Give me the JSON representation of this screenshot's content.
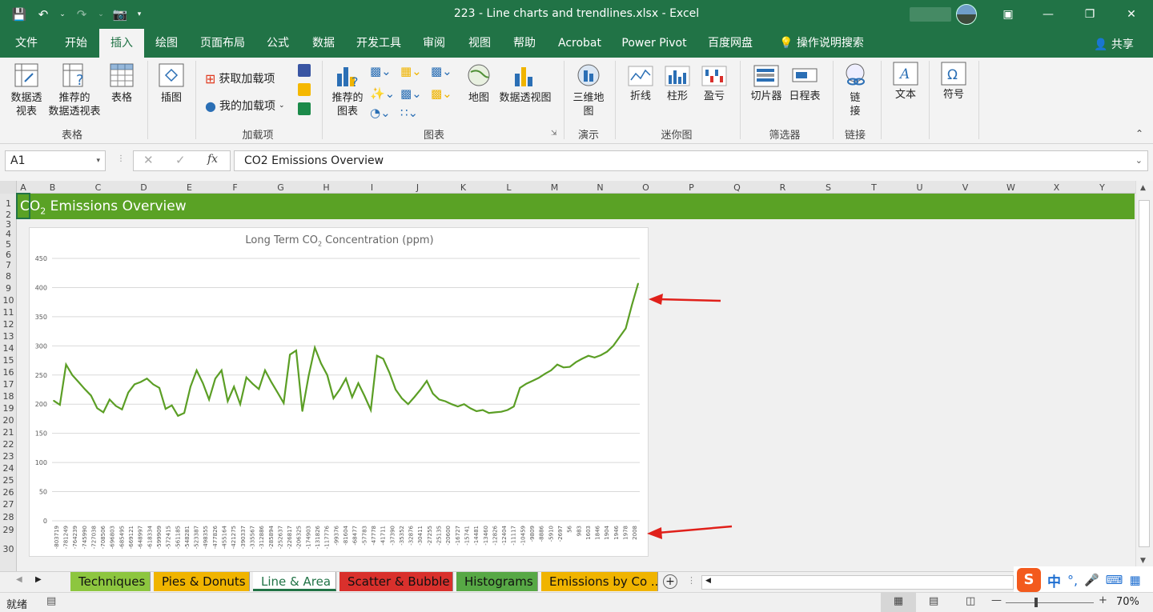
{
  "window": {
    "title": "223 - Line charts and trendlines.xlsx  -  Excel"
  },
  "menu": {
    "tabs": [
      "文件",
      "开始",
      "插入",
      "绘图",
      "页面布局",
      "公式",
      "数据",
      "开发工具",
      "审阅",
      "视图",
      "帮助",
      "Acrobat",
      "Power Pivot",
      "百度网盘"
    ],
    "active": "插入",
    "search": "操作说明搜索",
    "share": "共享"
  },
  "ribbon": {
    "tables": {
      "pivot": "数据透\n视表",
      "recommended_pivot": "推荐的\n数据透视表",
      "table": "表格",
      "label": "表格"
    },
    "illustrations": {
      "label": "插图"
    },
    "addins": {
      "get": "获取加载项",
      "my": "我的加载项",
      "label": "加载项"
    },
    "charts": {
      "recommended": "推荐的\n图表",
      "map": "地图",
      "pivot_chart": "数据透视图",
      "label": "图表"
    },
    "tours": {
      "map3d": "三维地\n图",
      "label": "演示"
    },
    "sparklines": {
      "line": "折线",
      "column": "柱形",
      "winloss": "盈亏",
      "label": "迷你图"
    },
    "filters": {
      "slicer": "切片器",
      "timeline": "日程表",
      "label": "筛选器"
    },
    "links": {
      "link": "链\n接",
      "label": "链接"
    },
    "text": {
      "label": "文本"
    },
    "symbols": {
      "label": "符号"
    }
  },
  "formula_bar": {
    "name_box": "A1",
    "fx": "fx",
    "content": "CO2 Emissions Overview"
  },
  "sheet": {
    "columns": [
      "A",
      "B",
      "C",
      "D",
      "E",
      "F",
      "G",
      "H",
      "I",
      "J",
      "K",
      "L",
      "M",
      "N",
      "O",
      "P",
      "Q",
      "R",
      "S",
      "T",
      "U",
      "V",
      "W",
      "X",
      "Y"
    ],
    "rows": [
      "1",
      "2",
      "3",
      "4",
      "5",
      "6",
      "7",
      "8",
      "9",
      "10",
      "11",
      "12",
      "13",
      "14",
      "15",
      "16",
      "17",
      "18",
      "19",
      "20",
      "21",
      "22",
      "23",
      "24",
      "25",
      "26",
      "27",
      "28",
      "29",
      "30"
    ],
    "banner": {
      "text": "CO",
      "sub": "2",
      "rest": " Emissions Overview"
    }
  },
  "chart_data": {
    "type": "line",
    "title": "Long Term CO",
    "title_sub": "2",
    "title_rest": " Concentration (ppm)",
    "xlabel": "",
    "ylabel": "",
    "ylim": [
      0,
      450
    ],
    "yticks": [
      0,
      50,
      100,
      150,
      200,
      250,
      300,
      350,
      400,
      450
    ],
    "grid": true,
    "line_color": "#5b9e25",
    "x_tick_labels": [
      "-803719",
      "-781249",
      "-764239",
      "-745990",
      "-727038",
      "-708506",
      "-696803",
      "-685495",
      "-669121",
      "-648997",
      "-618334",
      "-599909",
      "-572415",
      "-561185",
      "-548281",
      "-523387",
      "-498355",
      "-477826",
      "-455164",
      "-421275",
      "-390337",
      "-335567",
      "-312886",
      "-285894",
      "-252637",
      "-226817",
      "-206325",
      "-174903",
      "-131826",
      "-117776",
      "-99376",
      "-81604",
      "-68477",
      "-57783",
      "-47778",
      "-41711",
      "-37390",
      "-35352",
      "-32876",
      "-30411",
      "-27255",
      "-25135",
      "-20600",
      "-16727",
      "-15741",
      "-14481",
      "-13460",
      "-12826",
      "-12404",
      "-11117",
      "-10459",
      "-9809",
      "-8886",
      "-5910",
      "-2697",
      "56",
      "983",
      "1603",
      "1846",
      "1904",
      "1946",
      "1978",
      "2008"
    ],
    "series": [
      {
        "values": [
          206,
          199,
          268,
          250,
          238,
          226,
          215,
          193,
          186,
          208,
          197,
          191,
          220,
          234,
          238,
          244,
          234,
          228,
          192,
          198,
          180,
          185,
          230,
          258,
          236,
          208,
          244,
          258,
          205,
          230,
          200,
          246,
          235,
          226,
          258,
          238,
          220,
          202,
          285,
          292,
          188,
          248,
          297,
          270,
          250,
          210,
          225,
          244,
          212,
          236,
          214,
          190,
          283,
          278,
          254,
          225,
          210,
          200,
          212,
          225,
          240,
          218,
          208,
          205,
          200,
          196,
          200,
          193,
          188,
          190,
          185,
          186,
          187,
          190,
          196,
          228,
          235,
          240,
          245,
          252,
          258,
          268,
          263,
          264,
          272,
          278,
          283,
          280,
          284,
          290,
          300,
          315,
          330,
          370,
          407
        ]
      }
    ]
  },
  "sheet_tabs": {
    "tabs": [
      {
        "label": "Techniques",
        "color": "#8dc63f"
      },
      {
        "label": "Pies & Donuts",
        "color": "#f0b400"
      },
      {
        "label": "Line & Area",
        "color": "#ffffff"
      },
      {
        "label": "Scatter & Bubble",
        "color": "#d9302c"
      },
      {
        "label": "Histograms",
        "color": "#57a845"
      },
      {
        "label": "Emissions by Co ...",
        "color": "#f0b400"
      }
    ],
    "active": "Line & Area"
  },
  "statusbar": {
    "ready": "就绪",
    "zoom": "70%"
  },
  "ime": {
    "lang": "中"
  }
}
